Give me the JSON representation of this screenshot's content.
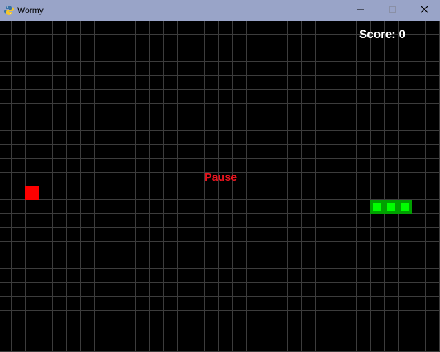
{
  "window": {
    "title": "Wormy",
    "app_icon": "python-snake-icon",
    "controls": [
      "minimize-icon",
      "maximize-icon",
      "close-icon"
    ]
  },
  "game": {
    "score_text": "Score: 0",
    "pause_text": "Pause",
    "grid_color": "#3c3c3c",
    "background_color": "#000000",
    "apple_color": "#ff0000",
    "worm_outer_color": "#00a000",
    "worm_inner_color": "#00ff00",
    "pause_color": "#e8141e"
  }
}
